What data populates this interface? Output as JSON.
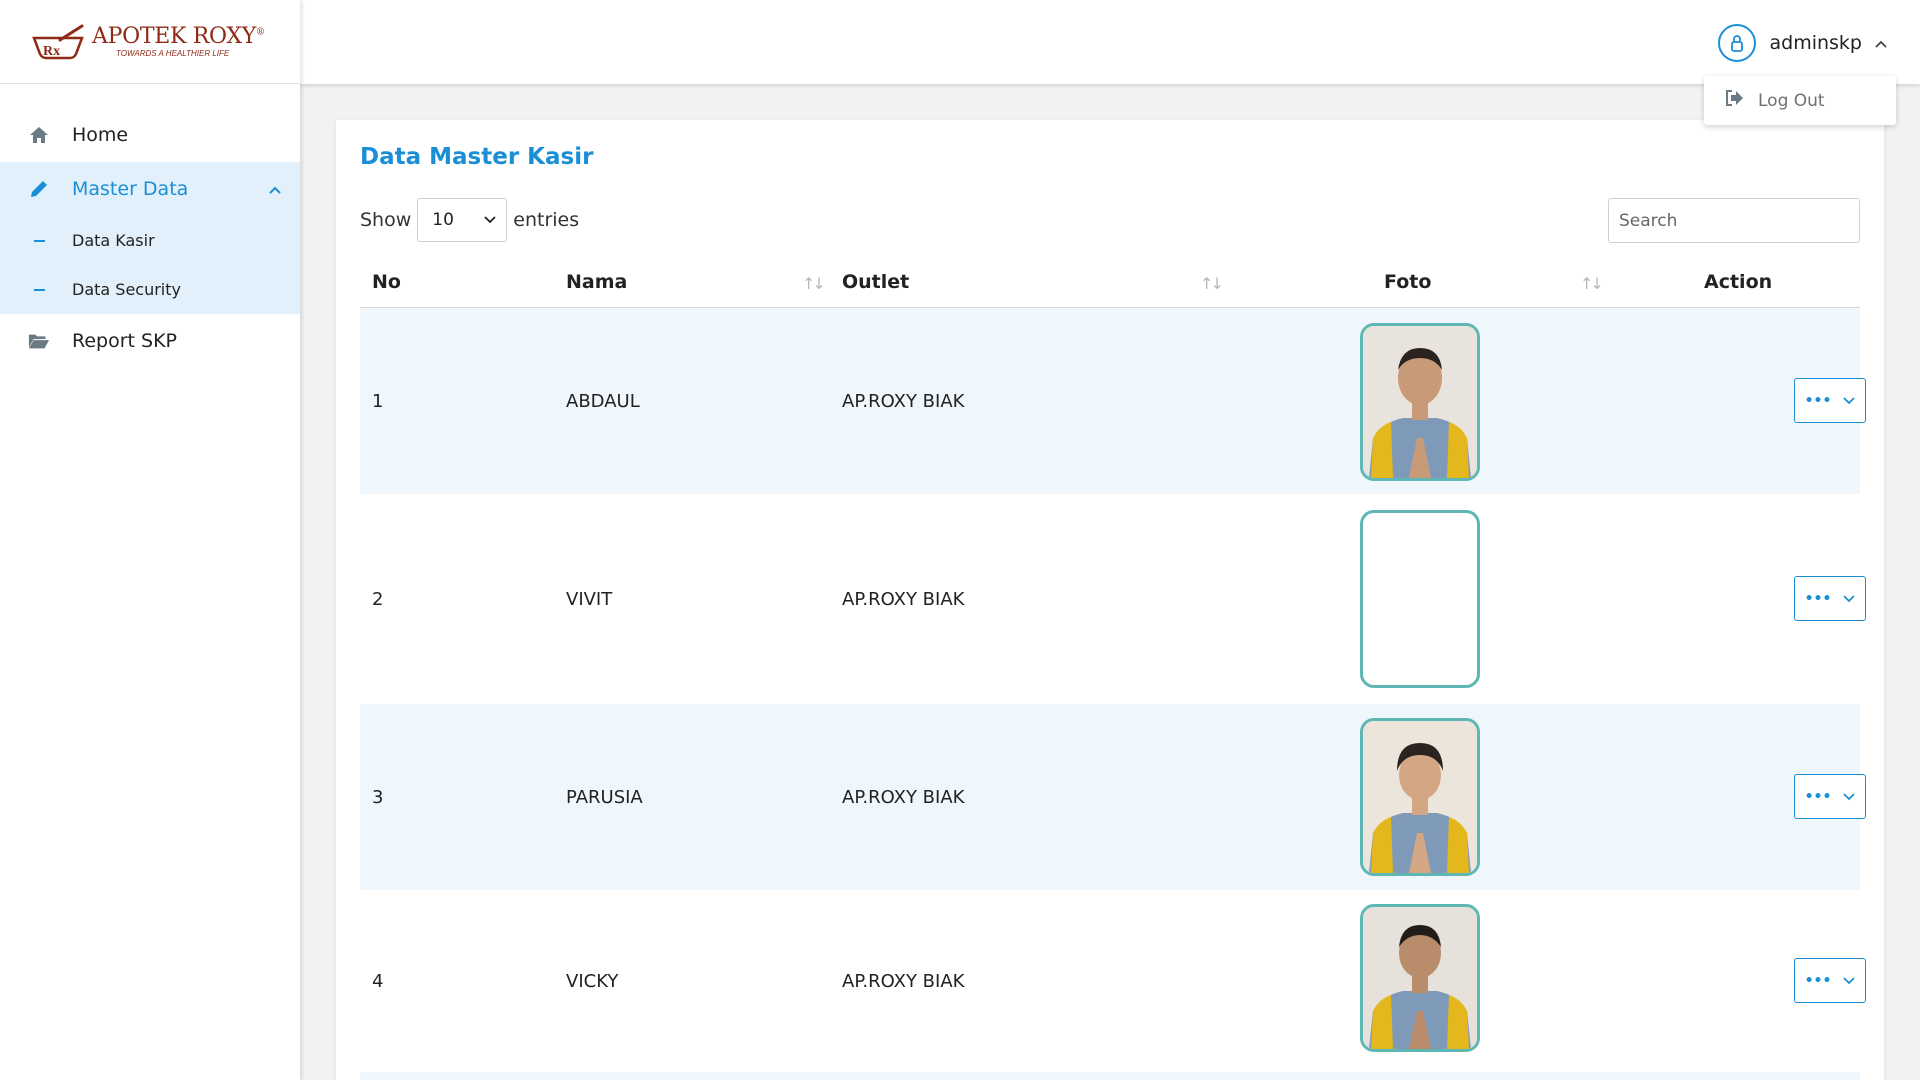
{
  "brand": {
    "name": "APOTEK ROXY",
    "tagline": "TOWARDS A HEALTHIER LIFE"
  },
  "sidebar": {
    "items": [
      {
        "label": "Home",
        "icon": "home-icon"
      },
      {
        "label": "Master Data",
        "icon": "pencil-icon",
        "expanded": true,
        "children": [
          {
            "label": "Data Kasir"
          },
          {
            "label": "Data Security"
          }
        ]
      },
      {
        "label": "Report SKP",
        "icon": "folder-icon"
      }
    ]
  },
  "header": {
    "user": "adminskp",
    "dropdown": {
      "logout": "Log Out"
    }
  },
  "main": {
    "title": "Data Master Kasir",
    "show_label": "Show",
    "entries_label": "entries",
    "page_length": "10",
    "search_placeholder": "Search",
    "columns": [
      "No",
      "Nama",
      "Outlet",
      "Foto",
      "Action"
    ],
    "rows": [
      {
        "no": "1",
        "nama": "ABDAUL",
        "outlet": "AP.ROXY BIAK",
        "foto": "male-staff-photo"
      },
      {
        "no": "2",
        "nama": "VIVIT",
        "outlet": "AP.ROXY BIAK",
        "foto": "blank-photo"
      },
      {
        "no": "3",
        "nama": "PARUSIA",
        "outlet": "AP.ROXY BIAK",
        "foto": "female-staff-photo"
      },
      {
        "no": "4",
        "nama": "VICKY",
        "outlet": "AP.ROXY BIAK",
        "foto": "male-staff-photo"
      }
    ]
  },
  "colors": {
    "accent": "#1a8fd6",
    "brand": "#8e2a16",
    "row_alt": "#eff6fc",
    "photo_border": "#5fb7b5"
  }
}
